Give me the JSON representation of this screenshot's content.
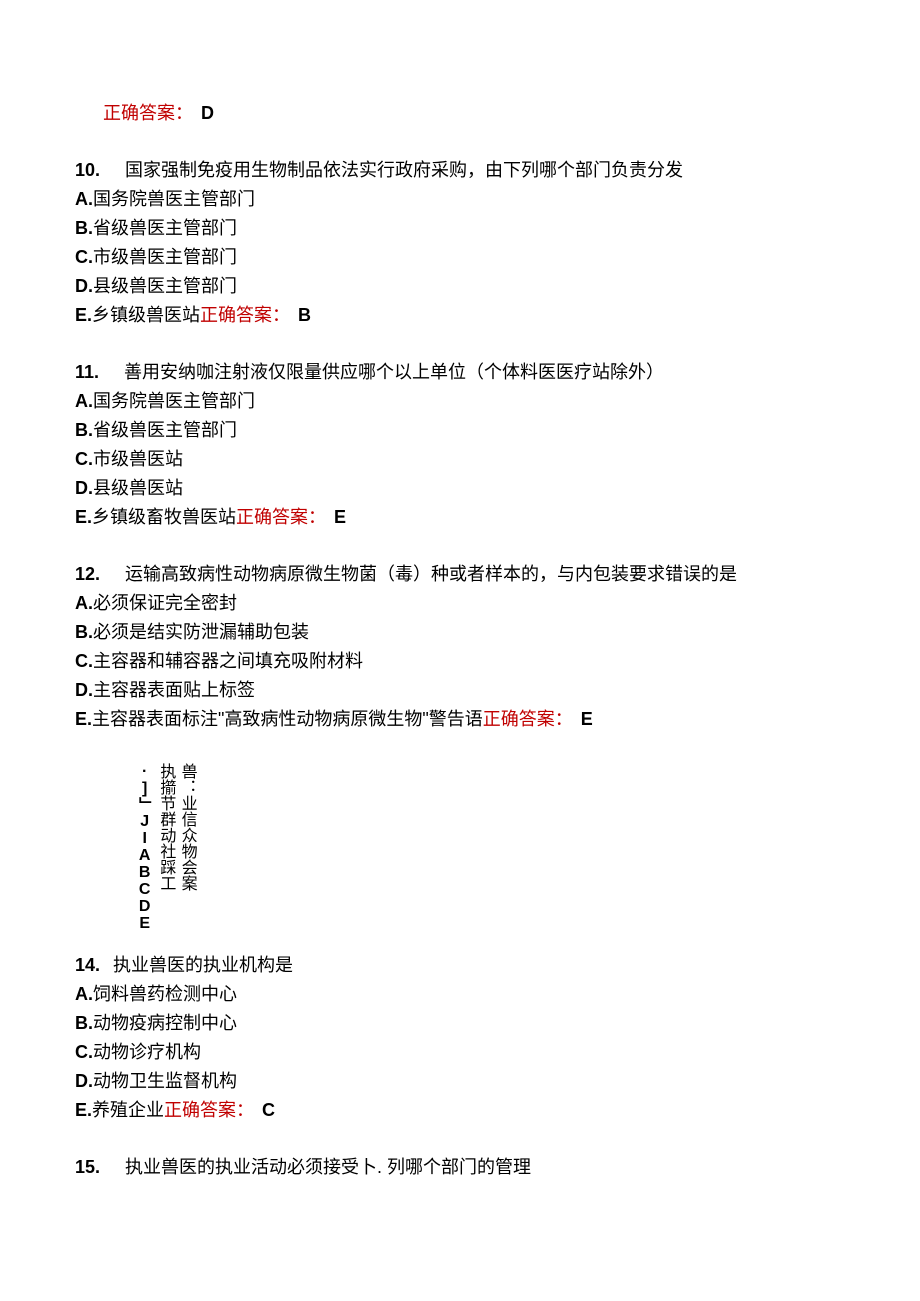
{
  "prev_answer": {
    "label": "正确答案：",
    "value": "D"
  },
  "questions": [
    {
      "number": "10.",
      "text": "国家强制免疫用生物制品依法实行政府采购，由下列哪个部门负责分发",
      "options": [
        {
          "letter": "A.",
          "text": "国务院兽医主管部门"
        },
        {
          "letter": "B.",
          "text": "省级兽医主管部门"
        },
        {
          "letter": "C.",
          "text": "市级兽医主管部门"
        },
        {
          "letter": "D.",
          "text": "县级兽医主管部门"
        },
        {
          "letter": "E.",
          "text": "乡镇级兽医站"
        }
      ],
      "answer": {
        "label": "正确答案：",
        "value": "B"
      }
    },
    {
      "number": "11.",
      "text": "善用安纳咖注射液仅限量供应哪个以上单位（个体料医医疗站除外）",
      "options": [
        {
          "letter": "A.",
          "text": "国务院兽医主管部门"
        },
        {
          "letter": "B.",
          "text": "省级兽医主管部门"
        },
        {
          "letter": "C.",
          "text": "市级兽医站"
        },
        {
          "letter": "D.",
          "text": "县级兽医站"
        },
        {
          "letter": "E.",
          "text": "乡镇级畜牧兽医站"
        }
      ],
      "answer": {
        "label": "正确答案：",
        "value": "E"
      }
    },
    {
      "number": "12.",
      "text": "运输高致病性动物病原微生物菌（毒）种或者样本的，与内包装要求错误的是",
      "options": [
        {
          "letter": "A.",
          "text": "必须保证完全密封"
        },
        {
          "letter": "B.",
          "text": "必须是结实防泄漏辅助包装"
        },
        {
          "letter": "C.",
          "text": "主容器和辅容器之间填充吸附材料"
        },
        {
          "letter": "D.",
          "text": "主容器表面贴上标签"
        },
        {
          "letter": "E.",
          "text": "主容器表面标注\"高致病性动物病原微生物\"警告语"
        }
      ],
      "answer": {
        "label": "正确答案：",
        "value": "E"
      }
    }
  ],
  "rotated": {
    "cols": [
      "兽：业信众物会案",
      "执擶节群动社踩工",
      "·]」JIABCDE"
    ]
  },
  "questions2": [
    {
      "number": "14.",
      "text": "执业兽医的执业机构是",
      "options": [
        {
          "letter": "A.",
          "text": "饲料兽药检测中心"
        },
        {
          "letter": "B.",
          "text": "动物疫病控制中心"
        },
        {
          "letter": "C.",
          "text": "动物诊疗机构"
        },
        {
          "letter": "D.",
          "text": "动物卫生监督机构"
        },
        {
          "letter": "E.",
          "text": "养殖企业"
        }
      ],
      "answer": {
        "label": "正确答案：",
        "value": "C"
      }
    },
    {
      "number": "15.",
      "text": "执业兽医的执业活动必须接受卜. 列哪个部门的管理",
      "options": [],
      "answer": null
    }
  ]
}
